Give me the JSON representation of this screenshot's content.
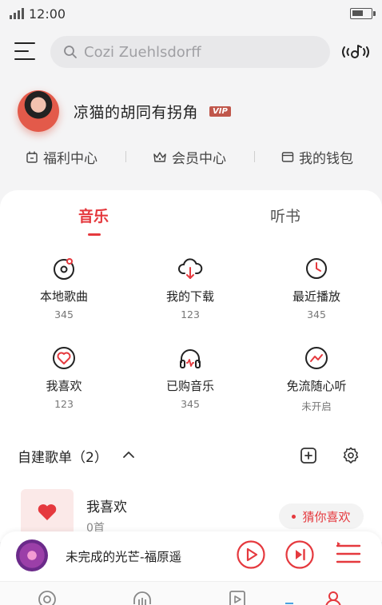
{
  "status_bar": {
    "time": "12:00",
    "battery_level": 0.6
  },
  "search": {
    "placeholder": "Cozi Zuehlsdorff"
  },
  "profile": {
    "username": "凉猫的胡同有拐角",
    "badge": "VIP"
  },
  "quick_links": [
    {
      "label": "福利中心",
      "icon": "gift-icon"
    },
    {
      "label": "会员中心",
      "icon": "crown-icon"
    },
    {
      "label": "我的钱包",
      "icon": "wallet-icon"
    }
  ],
  "tabs": {
    "active": "音乐",
    "inactive": "听书"
  },
  "grid": [
    {
      "label": "本地歌曲",
      "count": "345",
      "icon": "local-music-icon"
    },
    {
      "label": "我的下载",
      "count": "123",
      "icon": "cloud-download-icon"
    },
    {
      "label": "最近播放",
      "count": "345",
      "icon": "recent-play-icon"
    },
    {
      "label": "我喜欢",
      "count": "123",
      "icon": "heart-icon"
    },
    {
      "label": "已购音乐",
      "count": "345",
      "icon": "headphones-icon"
    },
    {
      "label": "免流随心听",
      "count": "未开启",
      "icon": "data-free-icon"
    }
  ],
  "playlists": {
    "header": "自建歌单（2）",
    "items": [
      {
        "name": "我喜欢",
        "count": "0首"
      }
    ],
    "guess_label": "猜你喜欢"
  },
  "player": {
    "song": "未完成的光芒-福原遥"
  },
  "colors": {
    "accent": "#e5393e",
    "background": "#f4f4f5"
  }
}
